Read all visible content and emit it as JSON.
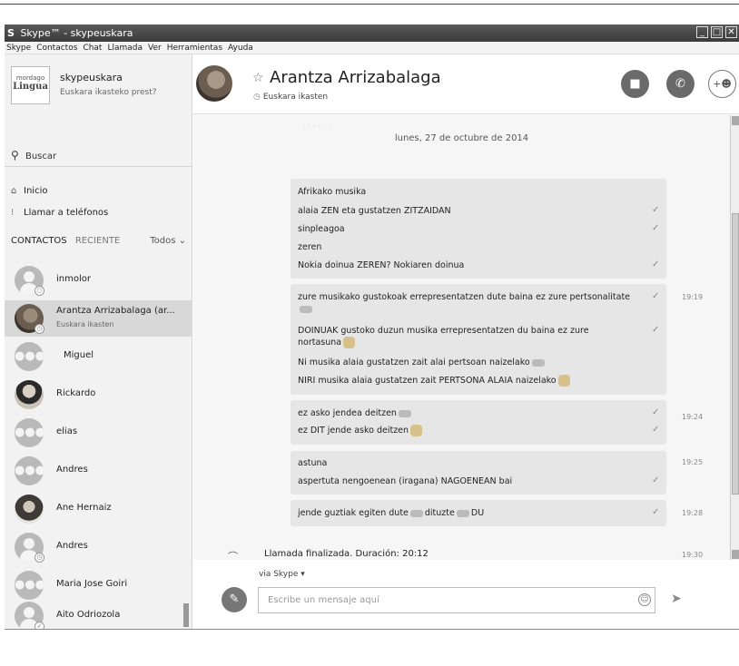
{
  "window": {
    "title": "Skype™ - skypeuskara",
    "logo": "S"
  },
  "menu": [
    "Skype",
    "Contactos",
    "Chat",
    "Llamada",
    "Ver",
    "Herramientas",
    "Ayuda"
  ],
  "profile": {
    "logo_top": "mordago",
    "logo_main": "Lingua",
    "name": "skypeuskara",
    "status": "Euskara ikasteko prest?"
  },
  "search": {
    "label": "Buscar"
  },
  "nav": {
    "home": "Inicio",
    "phones": "Llamar a teléfonos"
  },
  "tabs": {
    "contacts": "CONTACTOS",
    "recent": "RECIENTE",
    "filter": "Todos ⌄"
  },
  "contacts": [
    {
      "name": "inmolor",
      "status": "",
      "avatar": "person",
      "badge": "○"
    },
    {
      "name": "Arantza Arrizabalaga (ar...",
      "status": "Euskara ikasten",
      "avatar": "photo",
      "badge": "◷"
    },
    {
      "name": "Miguel",
      "status": "",
      "avatar": "group",
      "badge": ""
    },
    {
      "name": "Rickardo",
      "status": "",
      "avatar": "photo2",
      "badge": ""
    },
    {
      "name": "elias",
      "status": "",
      "avatar": "group",
      "badge": ""
    },
    {
      "name": "Andres",
      "status": "",
      "avatar": "group",
      "badge": ""
    },
    {
      "name": "Ane Hernaiz",
      "status": "",
      "avatar": "photo3",
      "badge": ""
    },
    {
      "name": "Andres",
      "status": "",
      "avatar": "person",
      "badge": "◷"
    },
    {
      "name": "Maria Jose Goiri",
      "status": "",
      "avatar": "group",
      "badge": ""
    },
    {
      "name": "Aito Odriozola",
      "status": "",
      "avatar": "person",
      "badge": "✓"
    }
  ],
  "chat": {
    "name": "Arantza Arrizabalaga",
    "status": "Euskara ikasten",
    "date": "lunes, 27 de octubre de 2014",
    "messages": [
      {
        "text": "Afrikako musika",
        "time": ""
      },
      {
        "text": "alaia ZEN eta gustatzen ZITZAIDAN",
        "time": ""
      },
      {
        "text": "sinpleagoa",
        "time": ""
      },
      {
        "text": "zeren",
        "time": ""
      },
      {
        "text": "Nokia doinua ZEREN? Nokiaren doinua",
        "time": ""
      },
      {
        "text": "zure musikako gustokoak errepresentatzen dute baina ez zure pertsonalitate",
        "time": "19:19"
      },
      {
        "text": "DOINUAK gustoko duzun musika errepresentatzen du baina ez zure nortasuna",
        "time": ""
      },
      {
        "text": "Ni musika alaia gustatzen zait alai pertsoan naizelako",
        "time": ""
      },
      {
        "text": "NIRI musika alaia gustatzen zait PERTSONA ALAIA naizelako",
        "time": ""
      },
      {
        "text": "ez asko jendea deitzen",
        "time": "19:24"
      },
      {
        "text": "ez DIT jende asko deitzen",
        "time": ""
      },
      {
        "text": "astuna",
        "time": "19:25"
      },
      {
        "text": "aspertuta nengoenean (iragana) NAGOENEAN bai",
        "time": ""
      },
      {
        "text": "jende guztiak egiten dute",
        "time": "19:28"
      }
    ],
    "msg_extra": {
      "word": "dituzte",
      "word2": "DU"
    },
    "call": {
      "text": "Llamada finalizada. Duración: 20:12",
      "time": "19:30"
    },
    "via": "via Skype ▾",
    "input_placeholder": "Escribe un mensaje aquí"
  },
  "colors": {
    "titlebar": "#4a4a4a",
    "sidebar": "#f2f2f2",
    "bubble": "#e6e6e6",
    "selected": "#d8d8d8"
  }
}
